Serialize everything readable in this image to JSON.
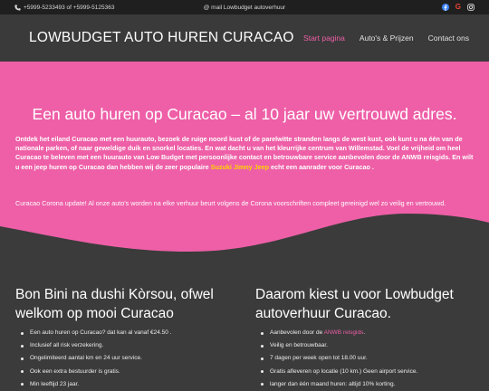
{
  "topbar": {
    "phone_text": "+5999-5233493 of +5999-5125363",
    "mail_text": "@ mail Lowbudget autoverhuur",
    "socials": [
      "facebook-icon",
      "google-icon",
      "instagram-icon"
    ]
  },
  "header": {
    "brand": "LOWBUDGET AUTO HUREN CURACAO",
    "nav": [
      "Start pagina",
      "Auto's & Prijzen",
      "Contact ons"
    ],
    "active_nav": "Start pagina"
  },
  "hero": {
    "title": "Een auto huren op Curacao – al 10 jaar uw vertrouwd adres.",
    "intro_before": "Ontdek het eiland Curacao met een huurauto, bezoek de ruige noord kust of de parelwitte stranden langs de west kust, ook kunt u na één van de nationale parken, of naar geweldige duik en snorkel locaties. En wat dacht u van het kleurrijke centrum van Willemstad. Voel de vrijheid om heel Curacao te beleven met een huurauto van Low Budget met persoonlijke contact en betrouwbare service aanbevolen door de ANWB reisgids. En wilt u een jeep huren op Curacao dan hebben wij de zeer populaire ",
    "intro_highlight": "Suzuki Jimny Jeep",
    "intro_after": " echt een aanrader voor Curacao .",
    "update": "Curacao Corona update! Al onze auto's worden na elke verhuur beurt volgens de Corona voorschriften compleet gereinigd wel zo veilig en vertrouwd."
  },
  "left_column": {
    "title": "Bon Bini na dushi Kòrsou, ofwel welkom op mooi Curacao",
    "items": [
      "Een auto huren op Curacao? dat kan al vanaf €24.50 .",
      "Inclusief all risk verzekering.",
      "Ongelimiteerd aantal km en 24 uur service.",
      "Ook een extra bestuurder is gratis.",
      "Min leeftijd 23 jaar."
    ]
  },
  "right_column": {
    "title": "Daarom kiest u voor Lowbudget autoverhuur Curacao.",
    "item0_before": "Aanbevolen door de ",
    "item0_link": "ANWB reisgids",
    "item0_after": ".",
    "items": [
      "Veilig en betrouwbaar.",
      "7 dagen per week open tot 18.00 uur.",
      "Gratis afleveren op locatie (10 km.) Geen airport service.",
      "langer dan één maand huren: altijd 10% korting."
    ]
  },
  "colors": {
    "pink": "#ee5fa7",
    "dark": "#3b3b3b",
    "topbar": "#1f1f1f",
    "highlight": "#ffd400"
  }
}
